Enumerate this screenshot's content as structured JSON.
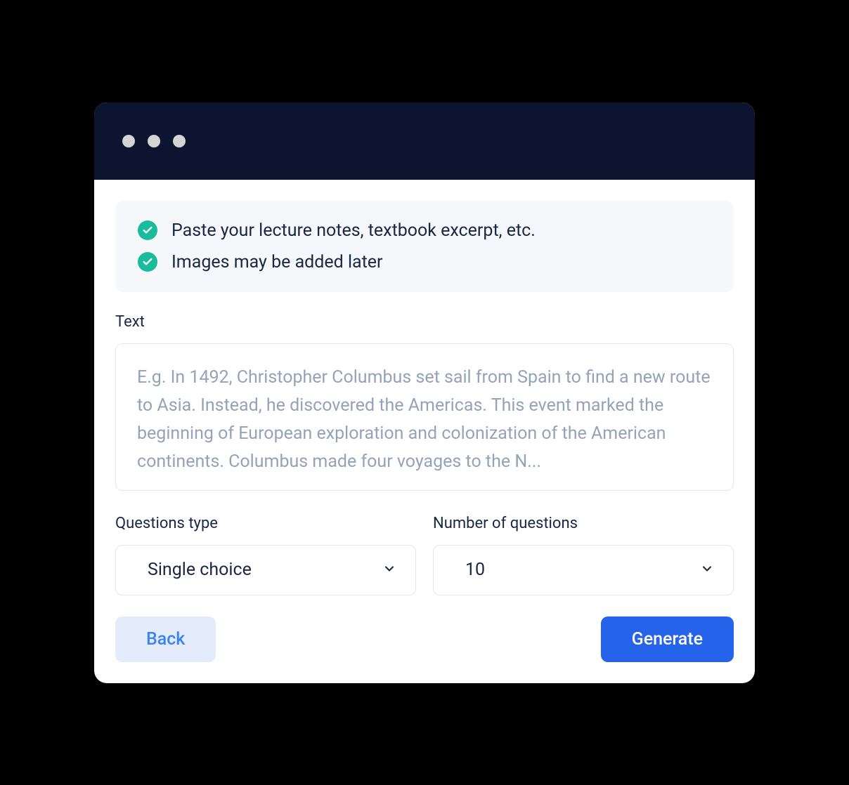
{
  "info": {
    "items": [
      "Paste your lecture notes, textbook excerpt, etc.",
      "Images may be added later"
    ]
  },
  "textarea": {
    "label": "Text",
    "placeholder": "E.g. In 1492, Christopher Columbus set sail from Spain to find a new route to Asia. Instead, he discovered the Americas. This event marked the beginning of European exploration and colonization of the American continents. Columbus made four voyages to the N..."
  },
  "questions_type": {
    "label": "Questions type",
    "value": "Single choice"
  },
  "number_of_questions": {
    "label": "Number of questions",
    "value": "10"
  },
  "buttons": {
    "back": "Back",
    "generate": "Generate"
  }
}
